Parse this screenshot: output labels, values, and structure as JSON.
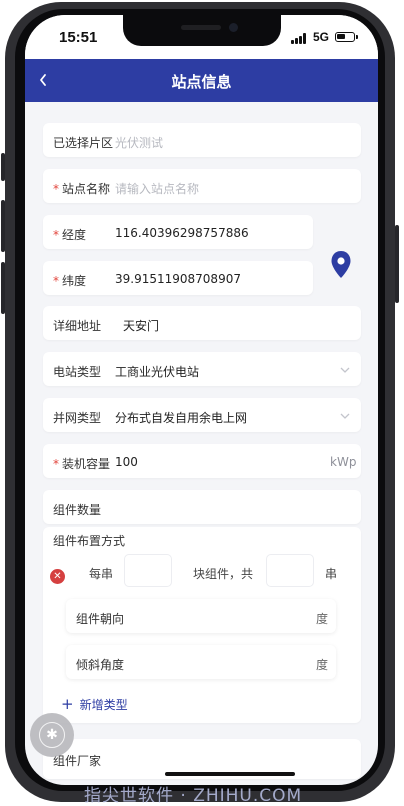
{
  "status_bar": {
    "time": "15:51",
    "network": "5G",
    "battery_level": 0.55
  },
  "nav": {
    "back_icon": "chevron-left-icon",
    "title": "站点信息",
    "color": "#2d3da3"
  },
  "form": {
    "district": {
      "label": "已选择片区",
      "value": "光伏测试"
    },
    "station_name": {
      "required_mark": "*",
      "label": "站点名称",
      "placeholder": "请输入站点名称"
    },
    "longitude": {
      "required_mark": "*",
      "label": "经度",
      "value": "116.40396298757886"
    },
    "latitude": {
      "required_mark": "*",
      "label": "纬度",
      "value": "39.91511908708907"
    },
    "location_icon": "map-pin-icon",
    "address": {
      "label": "详细地址",
      "value": "天安门"
    },
    "station_type": {
      "label": "电站类型",
      "value": "工商业光伏电站"
    },
    "grid_type": {
      "label": "并网类型",
      "value": "分布式自发自用余电上网"
    },
    "capacity": {
      "required_mark": "*",
      "label": "装机容量",
      "value": "100",
      "unit": "kWp"
    },
    "module_count": {
      "label": "组件数量"
    },
    "layout": {
      "label": "组件布置方式",
      "per_string_prefix": "每串",
      "per_string_value": "",
      "modules_mid": "块组件，共",
      "total_value": "",
      "string_suffix": "串",
      "orientation": {
        "label": "组件朝向",
        "unit": "度"
      },
      "tilt": {
        "label": "倾斜角度",
        "unit": "度"
      },
      "add_type": "新增类型"
    },
    "manufacturer": {
      "label": "组件厂家"
    }
  },
  "watermark": "指尖世软件 · ZHIHU.COM"
}
